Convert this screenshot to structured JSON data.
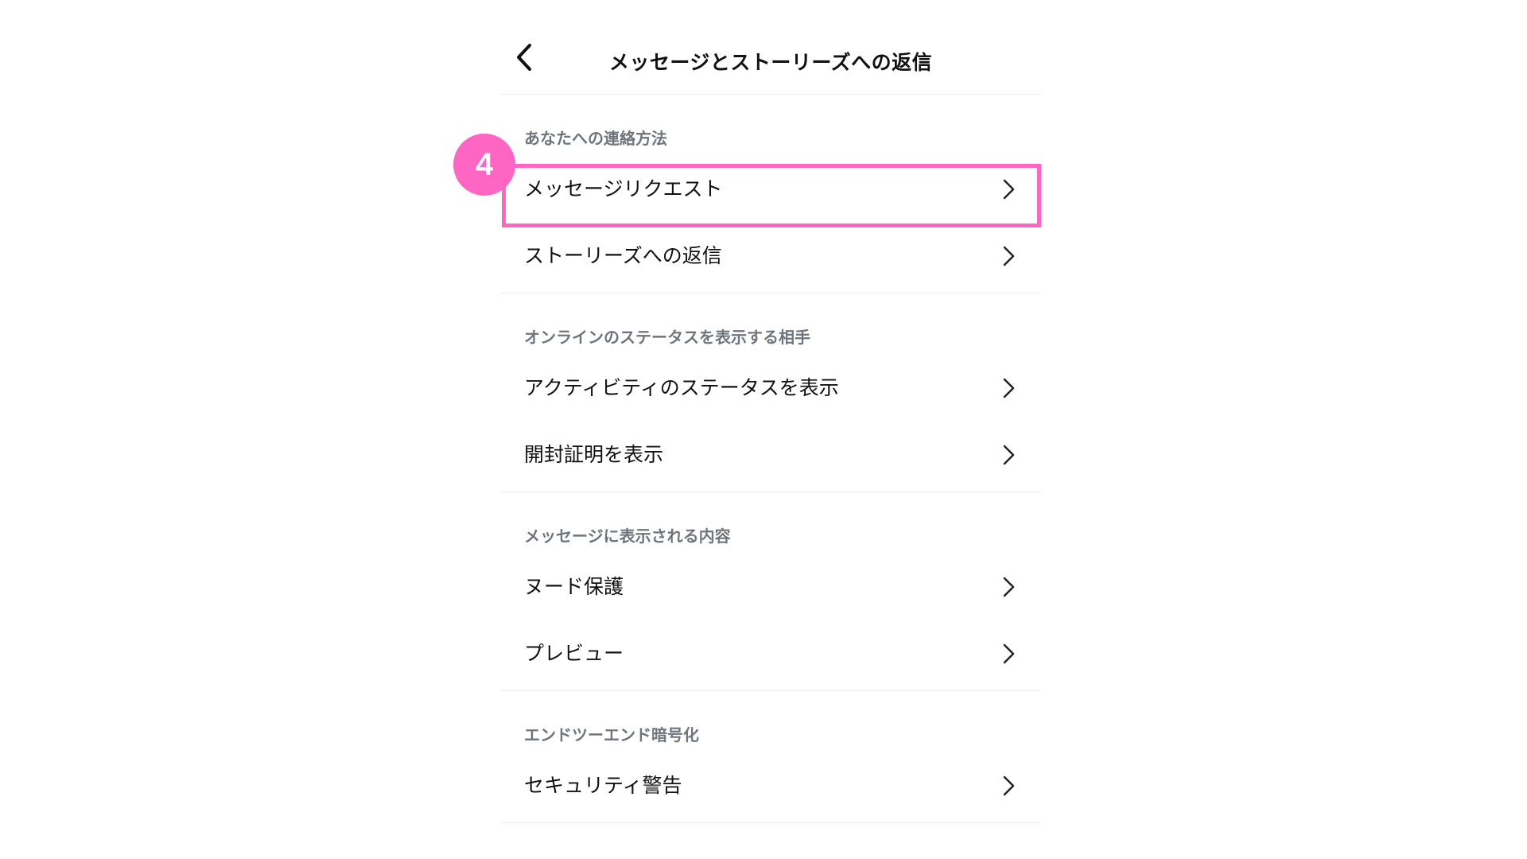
{
  "header": {
    "title": "メッセージとストーリーズへの返信",
    "back_icon": "chevron-left-icon"
  },
  "sections": [
    {
      "heading": "あなたへの連絡方法",
      "items": [
        {
          "label": "メッセージリクエスト"
        },
        {
          "label": "ストーリーズへの返信"
        }
      ]
    },
    {
      "heading": "オンラインのステータスを表示する相手",
      "items": [
        {
          "label": "アクティビティのステータスを表示"
        },
        {
          "label": "開封証明を表示"
        }
      ]
    },
    {
      "heading": "メッセージに表示される内容",
      "items": [
        {
          "label": "ヌード保護"
        },
        {
          "label": "プレビュー"
        }
      ]
    },
    {
      "heading": "エンドツーエンド暗号化",
      "items": [
        {
          "label": "セキュリティ警告"
        }
      ]
    }
  ],
  "annotation": {
    "step_number": "4",
    "highlight_color": "#ff66c4",
    "target": "メッセージリクエスト"
  },
  "colors": {
    "text": "#111111",
    "section_heading": "#70757d",
    "divider": "#eeeeee",
    "accent": "#ff66c4"
  }
}
